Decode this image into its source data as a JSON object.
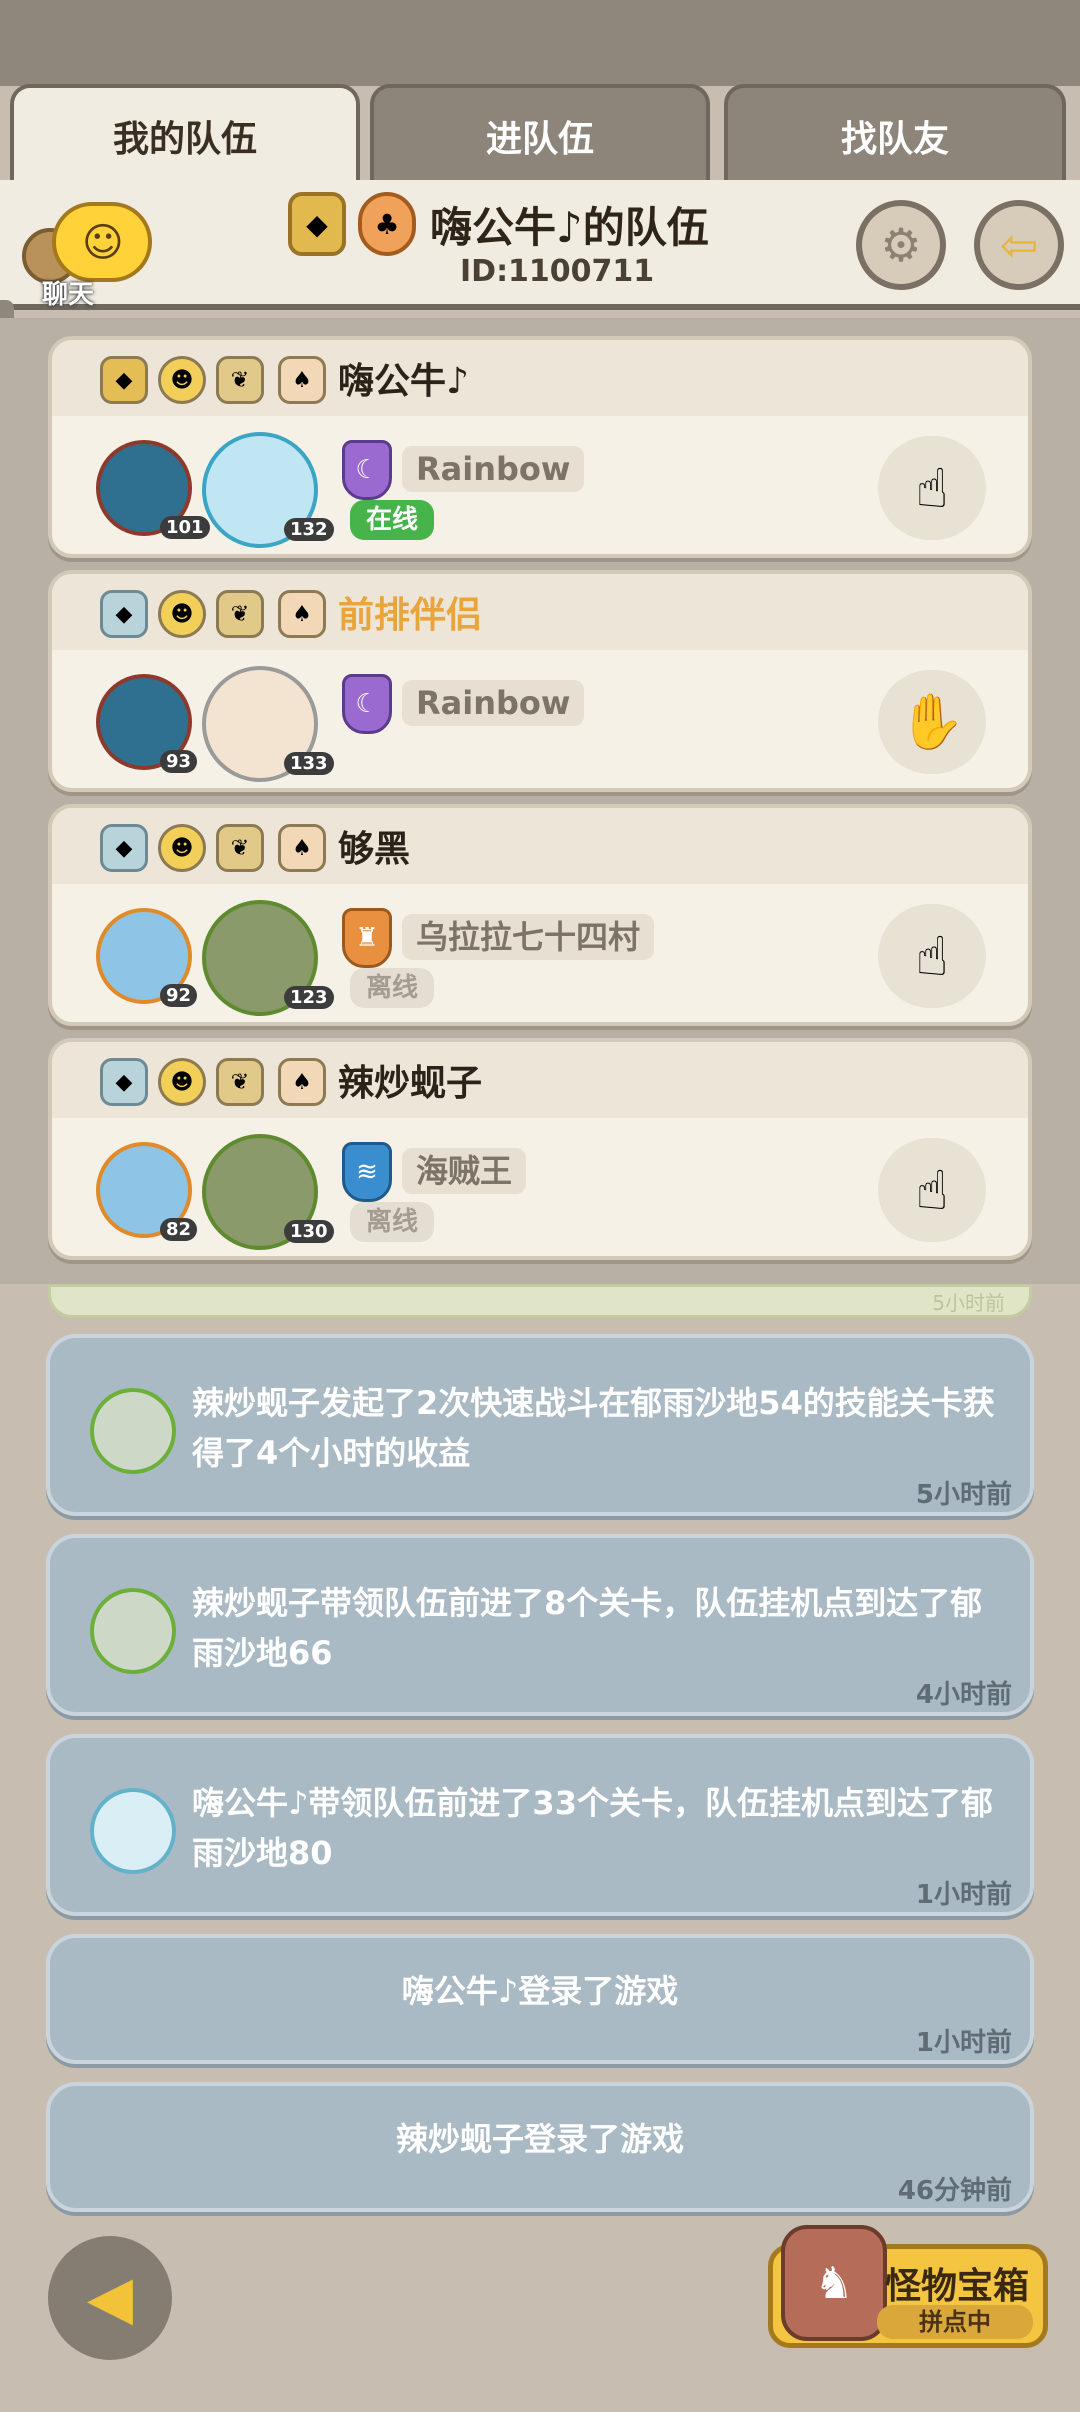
{
  "tabs": [
    {
      "label": "我的队伍",
      "active": true
    },
    {
      "label": "进队伍",
      "active": false
    },
    {
      "label": "找队友",
      "active": false
    }
  ],
  "header": {
    "chat_label": "聊天",
    "team_title": "嗨公牛♪的队伍",
    "team_id": "ID:1100711",
    "icons": [
      "rank-badge-icon",
      "mushroom-badge-icon",
      "settings-gear-icon",
      "exit-team-icon"
    ]
  },
  "members": [
    {
      "name": "嗨公牛♪",
      "pet_level": "101",
      "hero_level": "132",
      "guild": "Rainbow",
      "status": "在线",
      "status_type": "online",
      "highlight": false,
      "rank": "gold"
    },
    {
      "name": "前排伴侣",
      "pet_level": "93",
      "hero_level": "133",
      "guild": "Rainbow",
      "status": "",
      "status_type": "none",
      "highlight": true,
      "rank": "silver"
    },
    {
      "name": "够黑",
      "pet_level": "92",
      "hero_level": "123",
      "guild": "乌拉拉七十四村",
      "status": "离线",
      "status_type": "offline",
      "highlight": false,
      "rank": "silver"
    },
    {
      "name": "辣炒蚬子",
      "pet_level": "82",
      "hero_level": "130",
      "guild": "海贼王",
      "status": "离线",
      "status_type": "offline",
      "highlight": false,
      "rank": "silver"
    }
  ],
  "feed_partial_time": "5小时前",
  "feed": [
    {
      "text": "辣炒蚬子发起了2次快速战斗在郁雨沙地54的技能关卡获得了4个小时的收益",
      "time": "5小时前",
      "avatar": true
    },
    {
      "text": "辣炒蚬子带领队伍前进了8个关卡，队伍挂机点到达了郁雨沙地66",
      "time": "4小时前",
      "avatar": true
    },
    {
      "text": "嗨公牛♪带领队伍前进了33个关卡，队伍挂机点到达了郁雨沙地80",
      "time": "1小时前",
      "avatar": true
    },
    {
      "text": "嗨公牛♪登录了游戏",
      "time": "1小时前",
      "avatar": false
    },
    {
      "text": "辣炒蚬子登录了游戏",
      "time": "46分钟前",
      "avatar": false
    }
  ],
  "bottom": {
    "treasure_title": "怪物宝箱",
    "treasure_status": "拼点中"
  },
  "colors": {
    "accent_orange": "#e9a43b",
    "online_green": "#47b34b",
    "feed_bg": "#a9bac5",
    "panel_bg": "#f6f1e7"
  }
}
